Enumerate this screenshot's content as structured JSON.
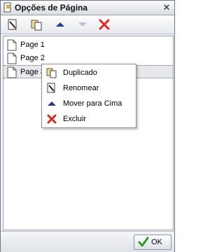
{
  "window": {
    "title": "Opções de Página",
    "close_glyph": "✕"
  },
  "toolbar": {
    "buttons": [
      {
        "name": "rename-icon"
      },
      {
        "name": "duplicate-icon"
      },
      {
        "name": "move-up-icon"
      },
      {
        "name": "move-down-icon",
        "disabled": true
      },
      {
        "name": "delete-icon"
      }
    ]
  },
  "pages": [
    {
      "label": "Page 1"
    },
    {
      "label": "Page 2"
    },
    {
      "label": "Page 3",
      "selected": true
    }
  ],
  "context_menu": {
    "items": [
      {
        "label": "Duplicado",
        "icon": "duplicate-icon"
      },
      {
        "label": "Renomear",
        "icon": "rename-icon"
      },
      {
        "label": "Mover para Cima",
        "icon": "move-up-icon"
      },
      {
        "label": "Excluir",
        "icon": "delete-icon"
      }
    ]
  },
  "footer": {
    "ok_label": "OK"
  },
  "colors": {
    "delete": "#e0271b",
    "arrow": "#1f3f86",
    "arrow_disabled": "#b8c4d8",
    "ok_check": "#2aa01e"
  }
}
